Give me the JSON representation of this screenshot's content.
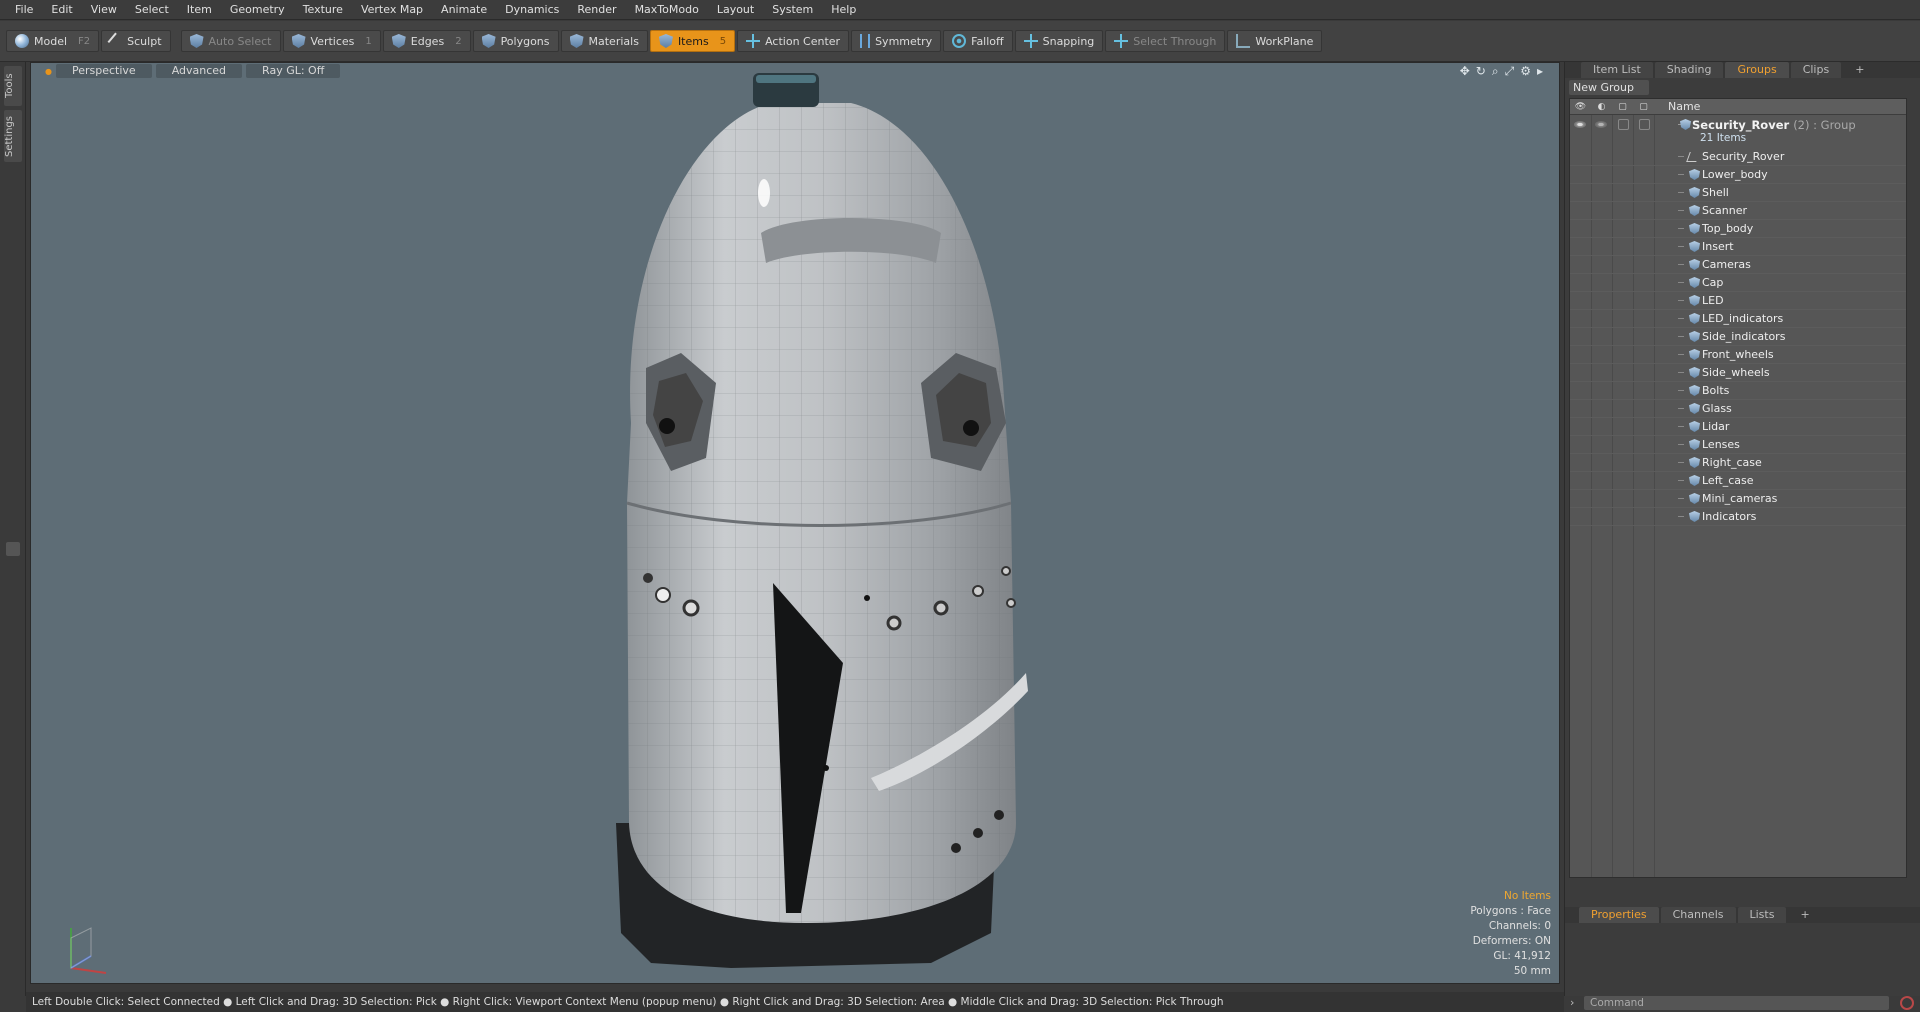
{
  "menu": [
    "File",
    "Edit",
    "View",
    "Select",
    "Item",
    "Geometry",
    "Texture",
    "Vertex Map",
    "Animate",
    "Dynamics",
    "Render",
    "MaxToModo",
    "Layout",
    "System",
    "Help"
  ],
  "toolbar": {
    "model": "Model",
    "model_key": "F2",
    "sculpt": "Sculpt",
    "auto_select": "Auto Select",
    "vertices": "Vertices",
    "vertices_key": "1",
    "edges": "Edges",
    "edges_key": "2",
    "polygons": "Polygons",
    "materials": "Materials",
    "items": "Items",
    "items_key": "5",
    "action_center": "Action Center",
    "symmetry": "Symmetry",
    "falloff": "Falloff",
    "snapping": "Snapping",
    "select_through": "Select Through",
    "workplane": "WorkPlane"
  },
  "left_tabs": [
    "Tools",
    "Settings"
  ],
  "viewport": {
    "view": "Perspective",
    "shading": "Advanced",
    "raygl": "Ray GL: Off",
    "stats": {
      "selection": "No Items",
      "polygons": "Polygons : Face",
      "channels": "Channels: 0",
      "deformers": "Deformers: ON",
      "gl": "GL: 41,912",
      "units": "50 mm"
    }
  },
  "right_panel": {
    "tabs": [
      "Item List",
      "Shading",
      "Groups",
      "Clips",
      "+"
    ],
    "active_tab": "Groups",
    "new_group": "New Group",
    "column_name": "Name",
    "group": {
      "name": "Security_Rover",
      "suffix": "(2) : Group",
      "count": "21 Items"
    },
    "items": [
      "Security_Rover",
      "Lower_body",
      "Shell",
      "Scanner",
      "Top_body",
      "Insert",
      "Cameras",
      "Cap",
      "LED",
      "LED_indicators",
      "Side_indicators",
      "Front_wheels",
      "Side_wheels",
      "Bolts",
      "Glass",
      "Lidar",
      "Lenses",
      "Right_case",
      "Left_case",
      "Mini_cameras",
      "Indicators"
    ],
    "lower_tabs": [
      "Properties",
      "Channels",
      "Lists",
      "+"
    ],
    "command_placeholder": "Command"
  },
  "status_bar": "Left Double Click: Select Connected ● Left Click and Drag: 3D Selection: Pick ● Right Click: Viewport Context Menu (popup menu) ● Right Click and Drag: 3D Selection: Area ● Middle Click and Drag: 3D Selection: Pick Through",
  "colors": {
    "accent": "#e8941a",
    "viewport_bg": "#5e6d76",
    "active_tab": "#f0a030"
  }
}
